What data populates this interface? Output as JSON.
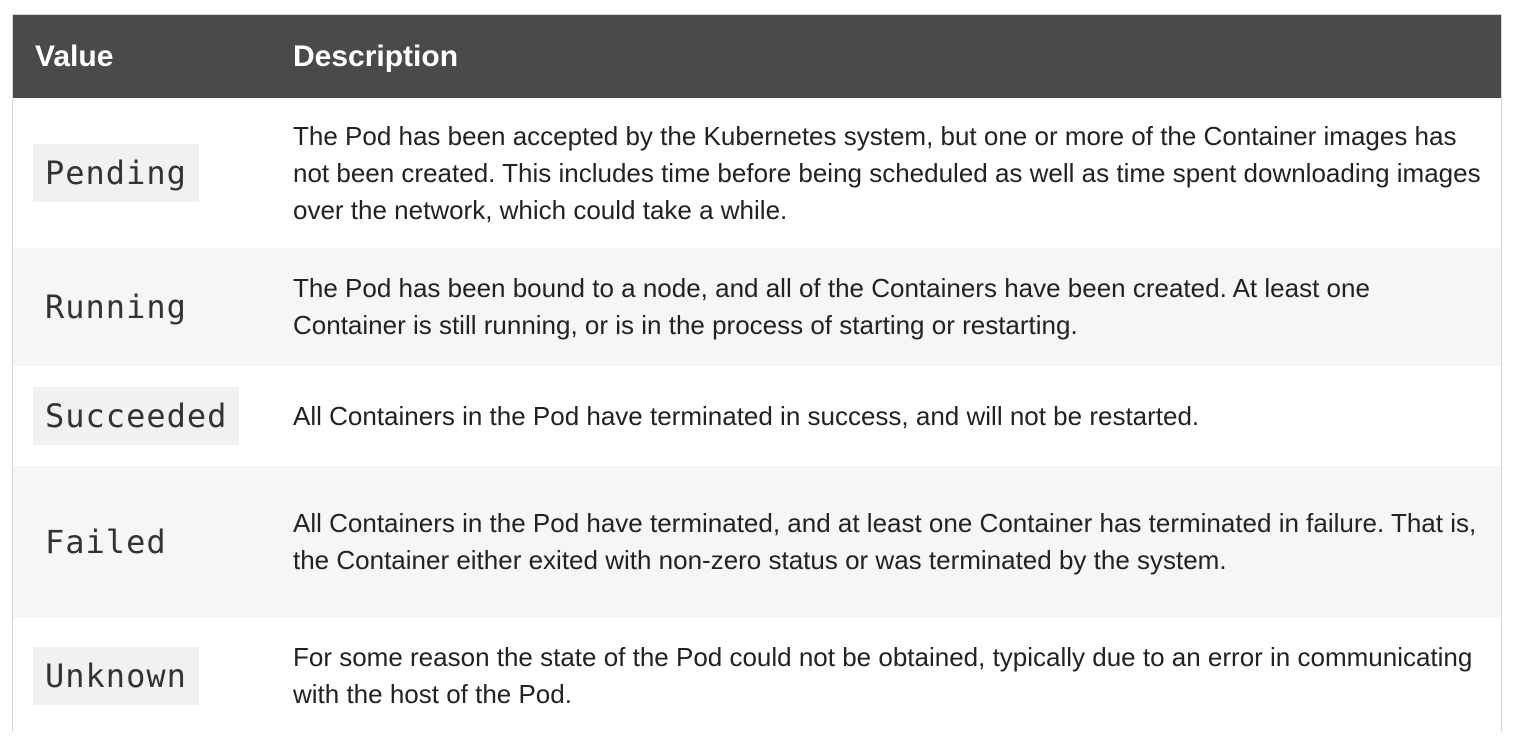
{
  "table": {
    "headers": {
      "value": "Value",
      "description": "Description"
    },
    "rows": [
      {
        "value": "Pending",
        "description": "The Pod has been accepted by the Kubernetes system, but one or more of the Container images has not been created. This includes time before being scheduled as well as time spent downloading images over the network, which could take a while."
      },
      {
        "value": "Running",
        "description": "The Pod has been bound to a node, and all of the Containers have been created. At least one Container is still running, or is in the process of starting or restarting."
      },
      {
        "value": "Succeeded",
        "description": "All Containers in the Pod have terminated in success, and will not be restarted."
      },
      {
        "value": "Failed",
        "description": "All Containers in the Pod have terminated, and at least one Container has terminated in failure. That is, the Container either exited with non-zero status or was terminated by the system."
      },
      {
        "value": "Unknown",
        "description": "For some reason the state of the Pod could not be obtained, typically due to an error in communicating with the host of the Pod."
      }
    ]
  },
  "colors": {
    "header_background": "#4a4a4a",
    "header_text": "#ffffff",
    "alt_row_background": "#f6f6f6"
  }
}
